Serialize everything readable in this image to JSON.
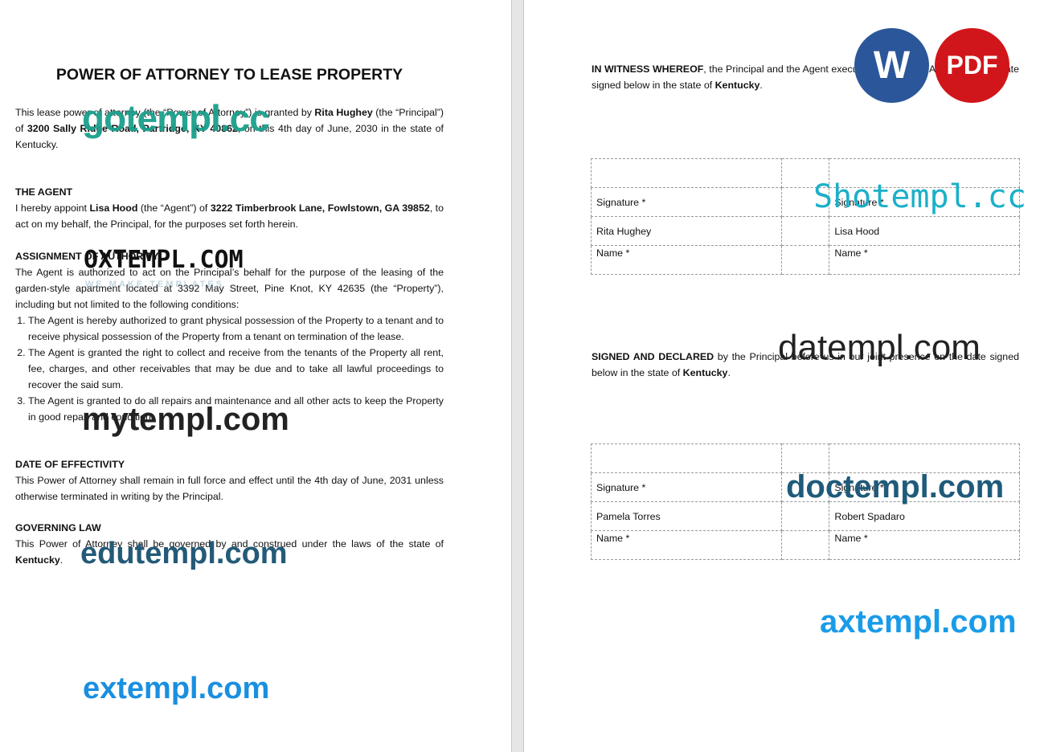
{
  "page1": {
    "title": "POWER OF ATTORNEY TO LEASE PROPERTY",
    "intro": {
      "a": "This lease power of attorney (the “Power of Attorney”) is granted by ",
      "principal": "Rita Hughey",
      "b": " (the “Principal”) of ",
      "address": "3200 Sally Ridge Road, Partridge, KY 40862",
      "c": ", on this 4th day of June, 2030 in the state of Kentucky."
    },
    "agent": {
      "heading": "THE AGENT",
      "a": "I hereby appoint ",
      "name": "Lisa Hood",
      "b": " (the “Agent”) of ",
      "address": "3222 Timberbrook Lane, Fowlstown, GA 39852",
      "c": ", to act on my behalf, the Principal, for the purposes set forth herein."
    },
    "assignment": {
      "heading": "ASSIGNMENT OF AUTHORITY",
      "text": "The Agent is authorized to act on the Principal’s behalf for the purpose of the leasing of the garden-style apartment located at 3392 May Street, Pine Knot, KY 42635 (the “Property”), including but not limited to the following conditions:",
      "items": [
        "The Agent is hereby authorized to grant physical possession of the Property to a tenant and to receive physical possession of the Property from a tenant on termination of the lease.",
        "The Agent is granted the right to collect and receive from the tenants of the Property all rent, fee, charges, and other receivables that may be due and to take all lawful proceedings to recover the said sum.",
        "The Agent is granted to do all repairs and maintenance and all other acts to keep the Property in good repair and condition."
      ]
    },
    "effectivity": {
      "heading": "DATE OF EFFECTIVITY",
      "text": "This Power of Attorney shall remain in full force and effect until the 4th day of June, 2031 unless otherwise terminated in writing by the Principal."
    },
    "law": {
      "heading": "GOVERNING LAW",
      "text": "This Power of Attorney shall be governed by and construed under the laws of the state of ",
      "state": "Kentucky",
      "end": "."
    }
  },
  "page2": {
    "witness": {
      "bold": "IN WITNESS WHEREOF",
      "text": ", the Principal and the Agent execute this Power of Attorney on the date signed below in the state of ",
      "state": "Kentucky",
      "end": "."
    },
    "table1": {
      "sig1": "Signature *",
      "sig2": "Signature *",
      "name1": "Rita Hughey",
      "name2": "Lisa Hood",
      "label1": "Name *",
      "label2": "Name *"
    },
    "declared": {
      "bold": "SIGNED AND DECLARED",
      "text": " by the Principal before us in our joint presence on the date signed below in the state of ",
      "state": "Kentucky",
      "end": "."
    },
    "table2": {
      "sig1": "Signature *",
      "sig2": "Signature *",
      "name1": "Pamela Torres",
      "name2": "Robert Spadaro",
      "label1": "Name *",
      "label2": "Name *"
    }
  },
  "badges": {
    "word": "W",
    "pdf": "PDF",
    "word_color": "#2b579a",
    "pdf_color": "#d0161a"
  },
  "watermarks": {
    "gotempl": "gotempl.cc",
    "oxtempl": "OXTEMPL.COM",
    "oxtempl_sub": "WE MAKE TEMPLATES",
    "mytempl": "mytempl.com",
    "edutempl": "edutempl.com",
    "extempl": "extempl.com",
    "shotempl": "Shotempl.cc",
    "datempl": "datempl.com",
    "doctempl": "doctempl.com",
    "axtempl": "axtempl.com"
  }
}
